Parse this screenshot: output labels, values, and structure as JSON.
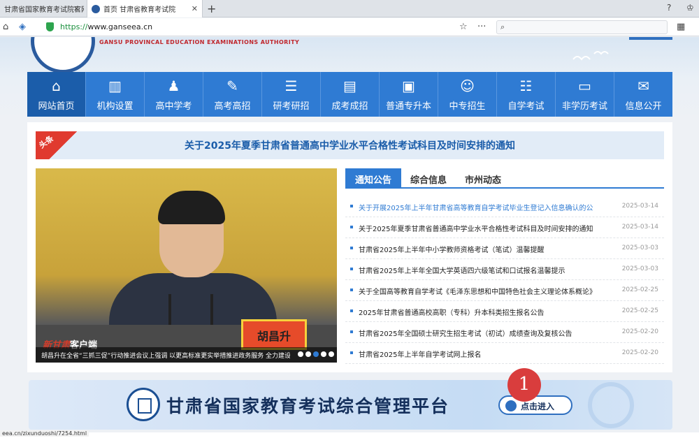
{
  "browser": {
    "tabs": [
      {
        "label": "甘肃省国家教育考试院官网"
      },
      {
        "label": "首页 甘肃省教育考试院"
      }
    ],
    "url_scheme": "https://",
    "url_host": "www.ganseea.cn",
    "status_url": "eea.cn/zixunduoshi/7254.html"
  },
  "site": {
    "org_en": "GANSU PROVINCAL EDUCATION EXAMINATIONS AUTHORITY",
    "nav": [
      {
        "label": "网站首页",
        "icon": "home-icon"
      },
      {
        "label": "机构设置",
        "icon": "building-icon"
      },
      {
        "label": "高中学考",
        "icon": "student-icon"
      },
      {
        "label": "高考高招",
        "icon": "exam-paper-icon"
      },
      {
        "label": "研考研招",
        "icon": "books-icon"
      },
      {
        "label": "成考成招",
        "icon": "document-icon"
      },
      {
        "label": "普通专升本",
        "icon": "graduation-icon"
      },
      {
        "label": "中专招生",
        "icon": "people-icon"
      },
      {
        "label": "自学考试",
        "icon": "list-icon"
      },
      {
        "label": "非学历考试",
        "icon": "certificate-icon"
      },
      {
        "label": "信息公开",
        "icon": "mail-icon"
      }
    ],
    "headline_tag": "头条",
    "headline": "关于2025年夏季甘肃省普通高中学业水平合格性考试科目及时间安排的通知",
    "photo": {
      "nameplate": "胡昌升",
      "watermark_red": "新甘肃",
      "watermark_white": "客户端",
      "caption": "胡昌升在全省“三抓三促”行动推进会议上强调 以更高标准更实举措推进政务服务 全力建设人民满意的服务型政府"
    },
    "notice_tabs": [
      "通知公告",
      "综合信息",
      "市州动态"
    ],
    "notices": [
      {
        "title": "关于开展2025年上半年甘肃省高等教育自学考试毕业生登记入信息确认的公",
        "date": "2025-03-14"
      },
      {
        "title": "关于2025年夏季甘肃省普通高中学业水平合格性考试科目及时间安排的通知",
        "date": "2025-03-14"
      },
      {
        "title": "甘肃省2025年上半年中小学教师资格考试（笔试）温馨提醒",
        "date": "2025-03-03"
      },
      {
        "title": "甘肃省2025年上半年全国大学英语四六级笔试和口试报名温馨提示",
        "date": "2025-03-03"
      },
      {
        "title": "关于全国高等教育自学考试《毛泽东思想和中国特色社会主义理论体系概论》",
        "date": "2025-02-25"
      },
      {
        "title": "2025年甘肃省普通高校高职（专科）升本科类招生报名公告",
        "date": "2025-02-25"
      },
      {
        "title": "甘肃省2025年全国硕士研究生招生考试（初试）成绩查询及复核公告",
        "date": "2025-02-20"
      },
      {
        "title": "甘肃省2025年上半年自学考试网上报名",
        "date": "2025-02-20"
      }
    ],
    "banner": {
      "title": "甘肃省国家教育考试综合管理平台",
      "button": "点击进入"
    },
    "annotation_badge": "1"
  }
}
